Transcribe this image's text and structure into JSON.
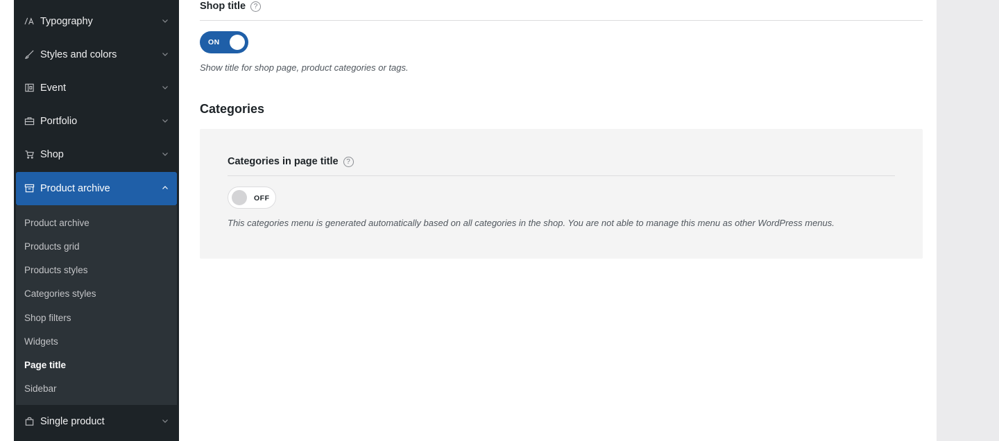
{
  "sidebar": {
    "items": [
      {
        "label": "Typography",
        "icon": "typography-icon"
      },
      {
        "label": "Styles and colors",
        "icon": "brush-icon"
      },
      {
        "label": "Event",
        "icon": "calendar-icon"
      },
      {
        "label": "Portfolio",
        "icon": "briefcase-icon"
      },
      {
        "label": "Shop",
        "icon": "cart-icon"
      },
      {
        "label": "Product archive",
        "icon": "archive-icon",
        "active": true
      },
      {
        "label": "Single product",
        "icon": "bag-icon"
      }
    ],
    "submenu": [
      {
        "label": "Product archive"
      },
      {
        "label": "Products grid"
      },
      {
        "label": "Products styles"
      },
      {
        "label": "Categories styles"
      },
      {
        "label": "Shop filters"
      },
      {
        "label": "Widgets"
      },
      {
        "label": "Page title",
        "current": true
      },
      {
        "label": "Sidebar"
      }
    ]
  },
  "main": {
    "shop_title": {
      "label": "Shop title",
      "help": "?",
      "toggle": "ON",
      "description": "Show title for shop page, product categories or tags."
    },
    "categories_heading": "Categories",
    "categories_in_title": {
      "label": "Categories in page title",
      "help": "?",
      "toggle": "OFF",
      "description": "This categories menu is generated automatically based on all categories in the shop. You are not able to manage this menu as other WordPress menus."
    }
  },
  "colors": {
    "sidebar_bg": "#1d2327",
    "submenu_bg": "#2c3338",
    "accent": "#1f5fa8",
    "panel_bg": "#f4f4f4"
  }
}
